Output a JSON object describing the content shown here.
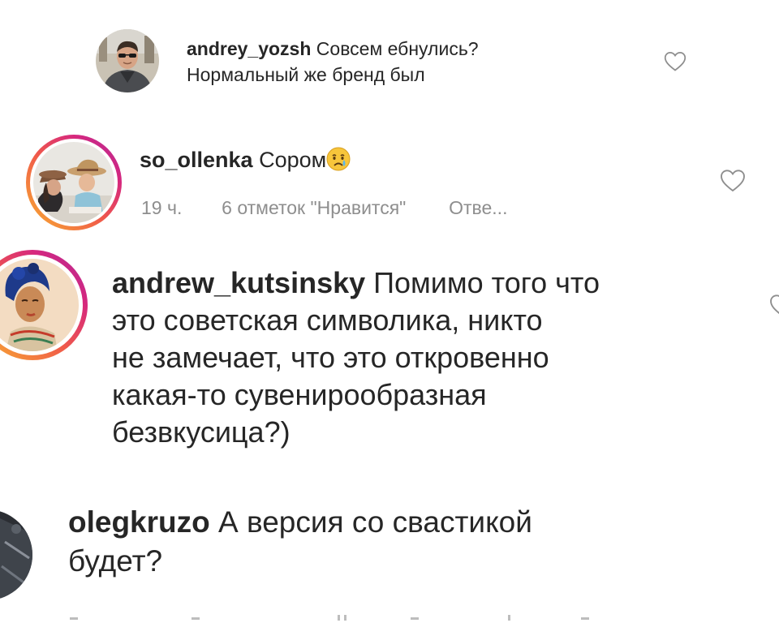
{
  "colors": {
    "text": "#262626",
    "meta": "#8e8e8e",
    "heart_stroke": "#8e8e8e",
    "story_ring_start": "#f8b030",
    "story_ring_end": "#b02a9a"
  },
  "comments": [
    {
      "username": "andrey_yozsh",
      "text_line1": "Совсем ебнулись?",
      "text_line2": "Нормальный же бренд был",
      "avatar_icon": "profile-photo-man-sunglasses",
      "like_icon": "heart-outline-icon"
    },
    {
      "username": "so_ollenka",
      "text": "Сором",
      "emoji": "crying-face-emoji",
      "time": "19 ч.",
      "likes": "6 отметок \"Нравится\"",
      "reply": "Отве...",
      "avatar_icon": "profile-photo-mother-child-hats",
      "like_icon": "heart-outline-icon"
    },
    {
      "username": "andrew_kutsinsky",
      "text_line1": "Помимо того что",
      "text_line2": "это советская символика, никто",
      "text_line3": "не замечает, что это откровенно",
      "text_line4": "какая-то сувенирообразная",
      "text_line5": "безвкусица?)",
      "avatar_icon": "profile-illustration-woman-blue-hair"
    },
    {
      "username": "olegkruzo",
      "text_line1": "А версия со свастикой",
      "text_line2": "будет?",
      "avatar_icon": "profile-photo-dark"
    }
  ]
}
